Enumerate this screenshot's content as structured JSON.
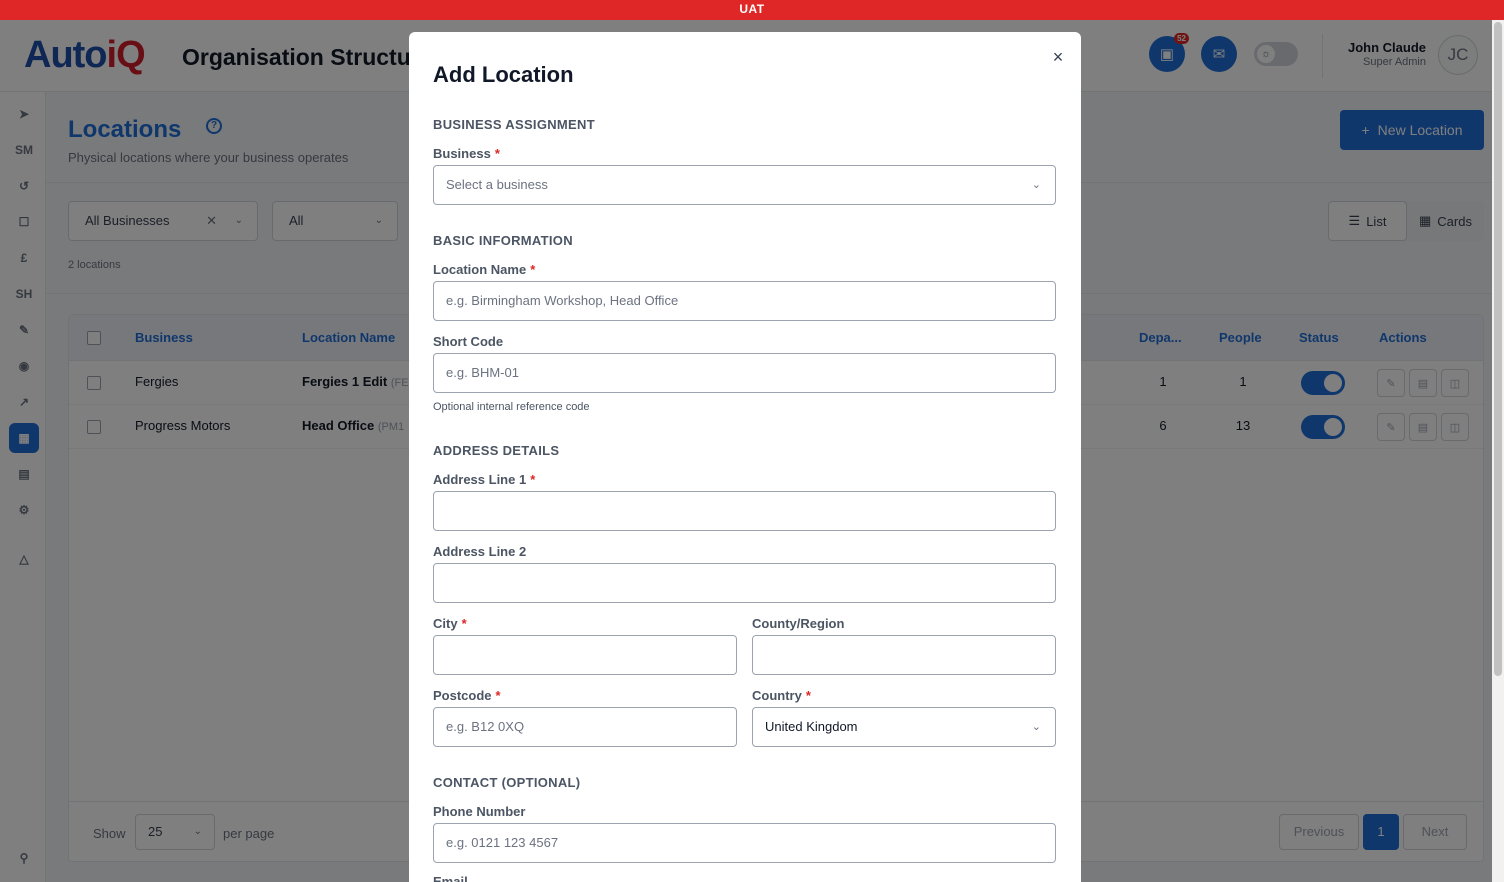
{
  "env_banner": "UAT",
  "header": {
    "logo_main": "Auto",
    "logo_accent": "iQ",
    "title": "Organisation Structure",
    "notification_count": "52",
    "user_name": "John Claude",
    "user_role": "Super Admin",
    "avatar_initials": "JC"
  },
  "sidebar": {
    "items": [
      "compass-icon",
      "sm-icon",
      "history-icon",
      "clipboard-icon",
      "finance-icon",
      "sh-icon",
      "edit-icon",
      "camera-icon",
      "chart-icon",
      "building-icon",
      "contacts-icon",
      "settings-icon",
      "flask-icon",
      "pin-icon"
    ],
    "sm_label": "SM",
    "sh_label": "SH"
  },
  "page": {
    "title": "Locations",
    "subtitle": "Physical locations where your business operates",
    "new_button": "New Location",
    "filter_business": "All Businesses",
    "filter_status": "All",
    "count_text": "2 locations",
    "view_list": "List",
    "view_cards": "Cards"
  },
  "table": {
    "headers": {
      "business": "Business",
      "location_name": "Location Name",
      "departments": "Depa...",
      "people": "People",
      "status": "Status",
      "actions": "Actions"
    },
    "rows": [
      {
        "business": "Fergies",
        "location": "Fergies 1 Edit",
        "code": "(FE",
        "departments": "1",
        "people": "1"
      },
      {
        "business": "Progress Motors",
        "location": "Head Office",
        "code": "(PM1",
        "departments": "6",
        "people": "13"
      }
    ]
  },
  "pagination": {
    "show": "Show",
    "page_size": "25",
    "per_page": "per page",
    "previous": "Previous",
    "current": "1",
    "next": "Next"
  },
  "modal": {
    "title": "Add Location",
    "close": "×",
    "sections": {
      "business": "BUSINESS ASSIGNMENT",
      "basic": "BASIC INFORMATION",
      "address": "ADDRESS DETAILS",
      "contact": "CONTACT (OPTIONAL)"
    },
    "fields": {
      "business_label": "Business",
      "business_placeholder": "Select a business",
      "location_name_label": "Location Name",
      "location_name_placeholder": "e.g. Birmingham Workshop, Head Office",
      "short_code_label": "Short Code",
      "short_code_placeholder": "e.g. BHM-01",
      "short_code_help": "Optional internal reference code",
      "address1_label": "Address Line 1",
      "address1_value": "",
      "address2_label": "Address Line 2",
      "address2_value": "",
      "city_label": "City",
      "city_value": "",
      "county_label": "County/Region",
      "county_value": "",
      "postcode_label": "Postcode",
      "postcode_placeholder": "e.g. B12 0XQ",
      "country_label": "Country",
      "country_value": "United Kingdom",
      "phone_label": "Phone Number",
      "phone_placeholder": "e.g. 0121 123 4567",
      "email_label": "Email"
    },
    "required_marker": "*"
  },
  "colors": {
    "primary": "#1e6fd9",
    "env_banner": "#e02727",
    "required": "#dc2626"
  }
}
